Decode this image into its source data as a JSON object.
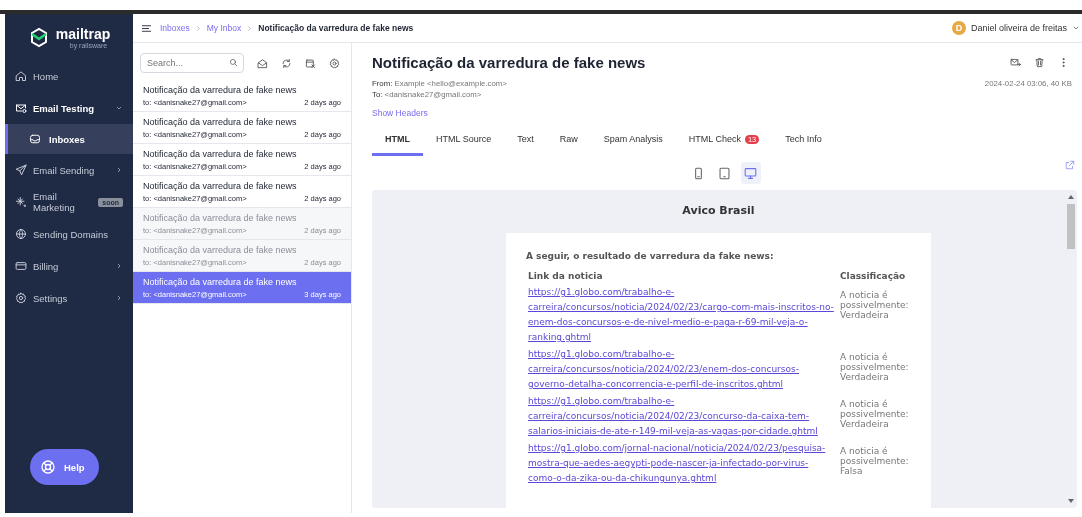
{
  "sidebar": {
    "logo": {
      "name": "mailtrap",
      "tagline": "by railsware"
    },
    "items": [
      {
        "kind": "home",
        "label": "Home",
        "expanded": false,
        "chevron": false
      },
      {
        "kind": "testing",
        "label": "Email Testing",
        "expanded": true,
        "chevron": true,
        "children": [
          {
            "kind": "inbox",
            "label": "Inboxes",
            "selected": true
          }
        ]
      },
      {
        "kind": "sending",
        "label": "Email Sending",
        "expanded": false,
        "chevron": true
      },
      {
        "kind": "marketing",
        "label": "Email Marketing",
        "badge": "soon",
        "expanded": false,
        "chevron": false
      },
      {
        "kind": "domains",
        "label": "Sending Domains",
        "expanded": false,
        "chevron": false
      },
      {
        "kind": "billing",
        "label": "Billing",
        "expanded": false,
        "chevron": true
      },
      {
        "kind": "settings",
        "label": "Settings",
        "expanded": false,
        "chevron": true
      }
    ],
    "help": "Help"
  },
  "breadcrumb": [
    "Inboxes",
    "My Inbox",
    "Notificação da varredura de fake news"
  ],
  "user": {
    "initial": "D",
    "name": "Daniel oliveira de freitas"
  },
  "search": {
    "placeholder": "Search..."
  },
  "messages": [
    {
      "subject": "Notificação da varredura de fake news",
      "to": "to: <danisnake27@gmail.com>",
      "time": "2 days ago",
      "read": false,
      "selected": false
    },
    {
      "subject": "Notificação da varredura de fake news",
      "to": "to: <danisnake27@gmail.com>",
      "time": "2 days ago",
      "read": false,
      "selected": false
    },
    {
      "subject": "Notificação da varredura de fake news",
      "to": "to: <danisnake27@gmail.com>",
      "time": "2 days ago",
      "read": false,
      "selected": false
    },
    {
      "subject": "Notificação da varredura de fake news",
      "to": "to: <danisnake27@gmail.com>",
      "time": "2 days ago",
      "read": false,
      "selected": false
    },
    {
      "subject": "Notificação da varredura de fake news",
      "to": "to: <danisnake27@gmail.com>",
      "time": "2 days ago",
      "read": true,
      "selected": false
    },
    {
      "subject": "Notificação da varredura de fake news",
      "to": "to: <danisnake27@gmail.com>",
      "time": "2 days ago",
      "read": true,
      "selected": false
    },
    {
      "subject": "Notificação da varredura de fake news",
      "to": "to: <danisnake27@gmail.com>",
      "time": "3 days ago",
      "read": true,
      "selected": true
    }
  ],
  "message": {
    "title": "Notificação da varredura de fake news",
    "from_label": "From:",
    "from": "Example <hello@example.com>",
    "to_label": "To:",
    "to": "<danisnake27@gmail.com>",
    "meta": "2024-02-24 03:06, 40 KB",
    "show_headers": "Show Headers",
    "tabs": [
      {
        "label": "HTML",
        "selected": true
      },
      {
        "label": "HTML Source",
        "selected": false
      },
      {
        "label": "Text",
        "selected": false
      },
      {
        "label": "Raw",
        "selected": false
      },
      {
        "label": "Spam Analysis",
        "selected": false
      },
      {
        "label": "HTML Check",
        "badge": "13",
        "selected": false
      },
      {
        "label": "Tech Info",
        "selected": false
      }
    ],
    "devices": [
      {
        "kind": "mobile",
        "selected": false
      },
      {
        "kind": "tablet",
        "selected": false
      },
      {
        "kind": "desktop",
        "selected": true
      }
    ]
  },
  "preview": {
    "heading": "Avico Brasil",
    "intro": "A seguir, o resultado de varredura da fake news:",
    "columns": [
      "Link da noticia",
      "Classificação"
    ],
    "rows": [
      {
        "link": "https://g1.globo.com/trabalho-e-carreira/concursos/noticia/2024/02/23/cargo-com-mais-inscritos-no-enem-dos-concursos-e-de-nivel-medio-e-paga-r-69-mil-veja-o-ranking.ghtml",
        "result": "A noticia é possivelmente: Verdadeira"
      },
      {
        "link": "https://g1.globo.com/trabalho-e-carreira/concursos/noticia/2024/02/23/enem-dos-concursos-governo-detalha-concorrencia-e-perfil-de-inscritos.ghtml",
        "result": "A noticia é possivelmente: Verdadeira"
      },
      {
        "link": "https://g1.globo.com/trabalho-e-carreira/concursos/noticia/2024/02/23/concurso-da-caixa-tem-salarios-iniciais-de-ate-r-149-mil-veja-as-vagas-por-cidade.ghtml",
        "result": "A noticia é possivelmente: Verdadeira"
      },
      {
        "link": "https://g1.globo.com/jornal-nacional/noticia/2024/02/23/pesquisa-mostra-que-aedes-aegypti-pode-nascer-ja-infectado-por-virus-como-o-da-zika-ou-da-chikungunya.ghtml",
        "result": "A noticia é possivelmente: Falsa"
      }
    ]
  }
}
